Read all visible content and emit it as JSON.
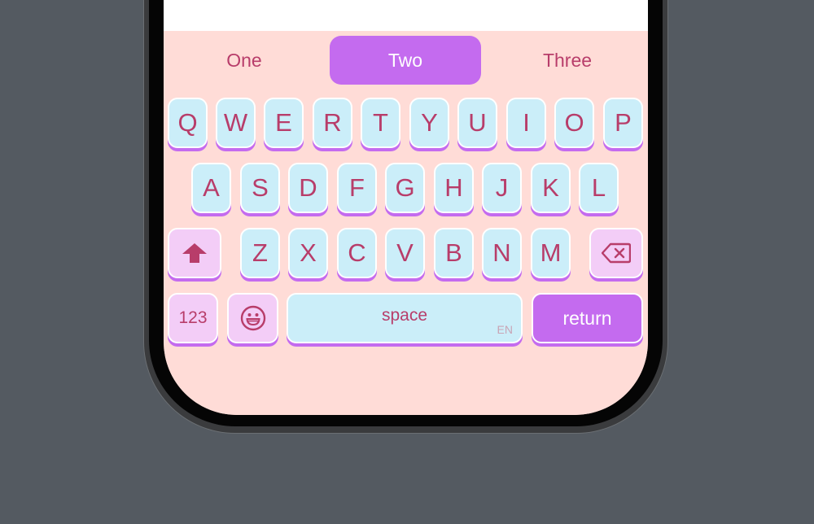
{
  "suggestions": [
    "One",
    "Two",
    "Three"
  ],
  "suggestion_selected": "Two",
  "rows": {
    "row1": [
      "Q",
      "W",
      "E",
      "R",
      "T",
      "Y",
      "U",
      "I",
      "O",
      "P"
    ],
    "row2": [
      "A",
      "S",
      "D",
      "F",
      "G",
      "H",
      "J",
      "K",
      "L"
    ],
    "row3": [
      "Z",
      "X",
      "C",
      "V",
      "B",
      "N",
      "M"
    ]
  },
  "bottom_row": {
    "numbers_label": "123",
    "space_label": "space",
    "language_label": "EN",
    "return_label": "return"
  },
  "icons": {
    "shift": "shift-arrow-icon",
    "backspace": "backspace-icon",
    "emoji": "emoji-face-icon"
  },
  "colors": {
    "background": "#545a61",
    "keyboard_bg": "#ffdcd7",
    "key_bg": "#cbeef9",
    "modifier_key_bg": "#f3cdf7",
    "accent": "#c46bef",
    "key_text": "#b83d6a"
  }
}
